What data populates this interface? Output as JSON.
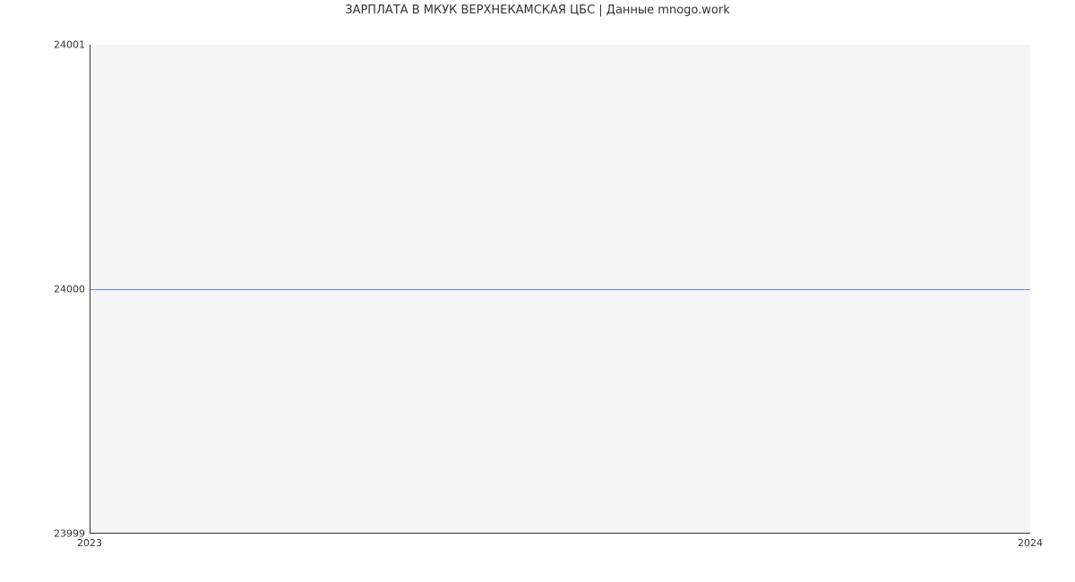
{
  "chart_data": {
    "type": "line",
    "title": "ЗАРПЛАТА В МКУК ВЕРХНЕКАМСКАЯ ЦБС | Данные mnogo.work",
    "xlabel": "",
    "ylabel": "",
    "x": [
      2023,
      2024
    ],
    "values": [
      24000,
      24000
    ],
    "xlim": [
      2023,
      2024
    ],
    "ylim": [
      23999,
      24001
    ],
    "x_ticks": [
      "2023",
      "2024"
    ],
    "y_ticks": [
      "23999",
      "24000",
      "24001"
    ],
    "line_color": "#3b7dd8",
    "plot_bg": "#f5f5f5"
  }
}
